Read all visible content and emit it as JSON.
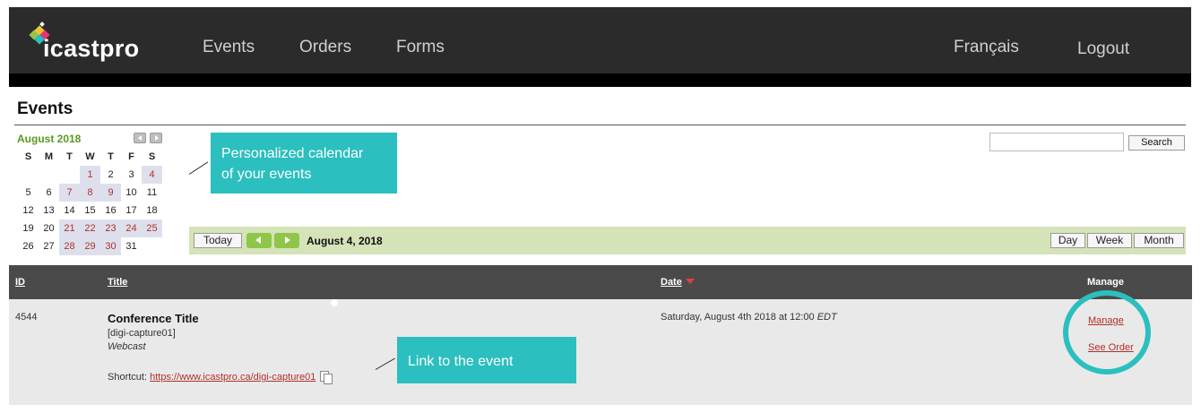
{
  "header": {
    "logo_text": "icastpro",
    "nav": [
      "Events",
      "Orders",
      "Forms"
    ],
    "language": "Français",
    "logout": "Logout"
  },
  "page_title": "Events",
  "calendar": {
    "month_label": "August 2018",
    "weekdays": [
      "S",
      "M",
      "T",
      "W",
      "T",
      "F",
      "S"
    ],
    "weeks": [
      [
        "",
        "",
        "",
        "1",
        "2",
        "3",
        "4"
      ],
      [
        "5",
        "6",
        "7",
        "8",
        "9",
        "10",
        "11"
      ],
      [
        "12",
        "13",
        "14",
        "15",
        "16",
        "17",
        "18"
      ],
      [
        "19",
        "20",
        "21",
        "22",
        "23",
        "24",
        "25"
      ],
      [
        "26",
        "27",
        "28",
        "29",
        "30",
        "31",
        ""
      ]
    ],
    "event_days": [
      "1",
      "4",
      "7",
      "8",
      "9",
      "21",
      "22",
      "23",
      "24",
      "25",
      "28",
      "29",
      "30"
    ]
  },
  "search": {
    "value": "",
    "button": "Search"
  },
  "toolbar": {
    "today": "Today",
    "current_date": "August 4, 2018",
    "views": [
      "Day",
      "Week",
      "Month"
    ]
  },
  "table": {
    "headers": {
      "id": "ID",
      "title": "Title",
      "date": "Date",
      "manage": "Manage"
    },
    "rows": [
      {
        "id": "4544",
        "title": "Conference Title",
        "code": "[digi-capture01]",
        "type": "Webcast",
        "shortcut_label": "Shortcut:",
        "shortcut_url": "https://www.icastpro.ca/digi-capture01",
        "date": "Saturday, August 4th 2018 at 12:00",
        "timezone": "EDT",
        "manage": "Manage",
        "see_order": "See Order"
      }
    ]
  },
  "callouts": {
    "calendar_line1": "Personalized calendar",
    "calendar_line2": "of your events",
    "link": "Link to the event"
  },
  "colors": {
    "nav_bg": "#2b2b2b",
    "accent_teal": "#2bbfbf",
    "toolbar_green": "#d4e3b8",
    "link_red": "#b0302a",
    "month_green": "#5a9a1e"
  }
}
